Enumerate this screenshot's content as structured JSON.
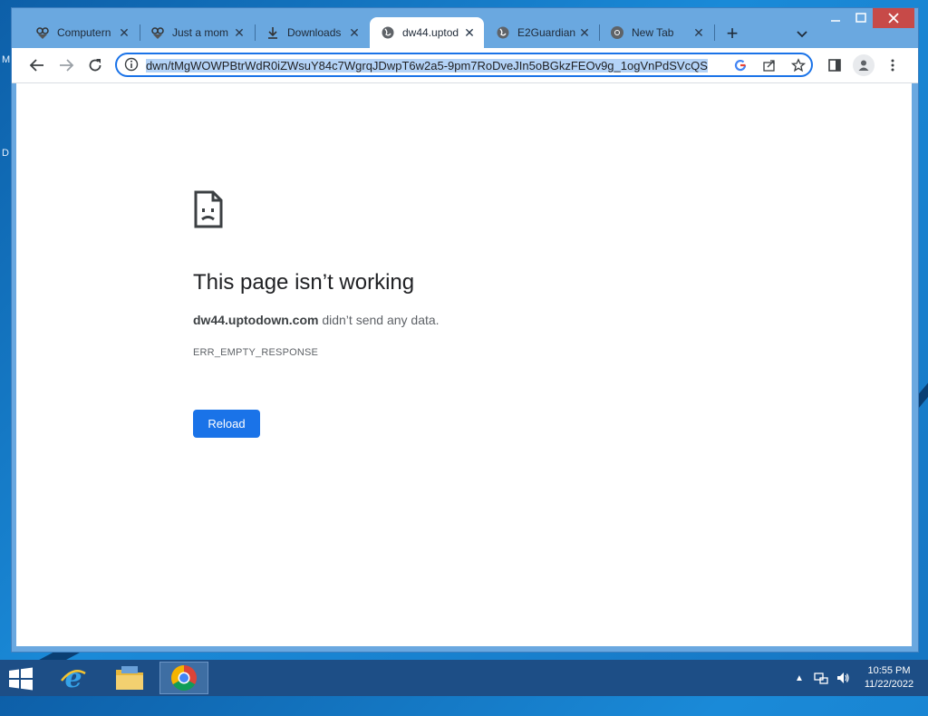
{
  "desktop": {
    "edge_letters": [
      "M",
      "D"
    ]
  },
  "browser": {
    "tabs": [
      {
        "title": "Computern",
        "icon": "owl-icon",
        "active": false
      },
      {
        "title": "Just a mom",
        "icon": "owl-icon",
        "active": false
      },
      {
        "title": "Downloads",
        "icon": "download-icon",
        "active": false
      },
      {
        "title": "dw44.uptod",
        "icon": "globe-icon",
        "active": true
      },
      {
        "title": "E2Guardian",
        "icon": "globe-icon",
        "active": false
      },
      {
        "title": "New Tab",
        "icon": "chrome-icon",
        "active": false
      }
    ],
    "new_tab_label": "+",
    "address": {
      "url": "dwn/tMgWOWPBtrWdR0iZWsuY84c7WgrqJDwpT6w2a5-9pm7RoDveJIn5oBGkzFEOv9g_1ogVnPdSVcQS",
      "selected": true
    }
  },
  "page": {
    "title": "This page isn’t working",
    "host": "dw44.uptodown.com",
    "message": " didn’t send any data.",
    "error_code": "ERR_EMPTY_RESPONSE",
    "reload_label": "Reload"
  },
  "taskbar": {
    "apps": [
      "internet-explorer",
      "file-explorer",
      "chrome"
    ],
    "active_app": "chrome",
    "time": "10:55 PM",
    "date": "11/22/2022"
  },
  "colors": {
    "accent": "#1a73e8",
    "selection": "#b4d3f7",
    "tabstrip": "#6aa8e0",
    "taskbar": "#1d4e86",
    "close_button": "#c74a48"
  }
}
